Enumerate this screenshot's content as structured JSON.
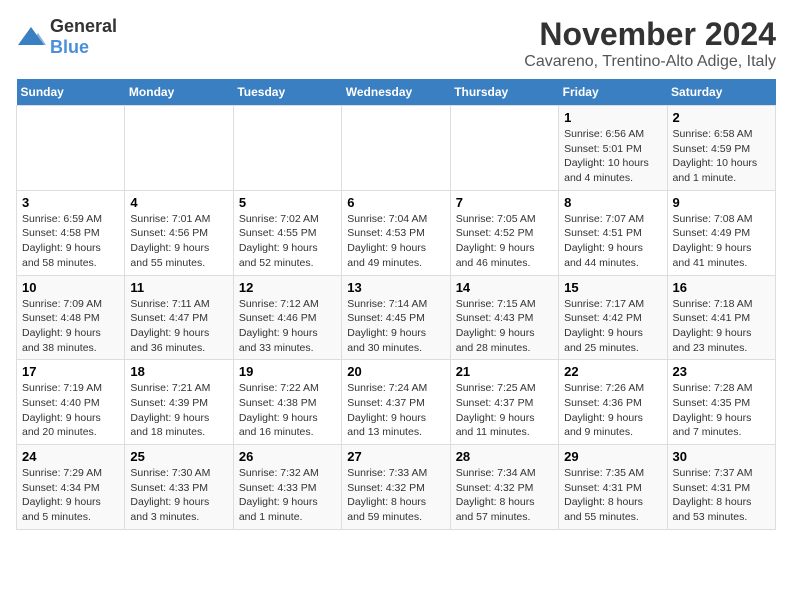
{
  "header": {
    "logo_general": "General",
    "logo_blue": "Blue",
    "title": "November 2024",
    "subtitle": "Cavareno, Trentino-Alto Adige, Italy"
  },
  "weekdays": [
    "Sunday",
    "Monday",
    "Tuesday",
    "Wednesday",
    "Thursday",
    "Friday",
    "Saturday"
  ],
  "weeks": [
    [
      {
        "day": "",
        "info": ""
      },
      {
        "day": "",
        "info": ""
      },
      {
        "day": "",
        "info": ""
      },
      {
        "day": "",
        "info": ""
      },
      {
        "day": "",
        "info": ""
      },
      {
        "day": "1",
        "info": "Sunrise: 6:56 AM\nSunset: 5:01 PM\nDaylight: 10 hours and 4 minutes."
      },
      {
        "day": "2",
        "info": "Sunrise: 6:58 AM\nSunset: 4:59 PM\nDaylight: 10 hours and 1 minute."
      }
    ],
    [
      {
        "day": "3",
        "info": "Sunrise: 6:59 AM\nSunset: 4:58 PM\nDaylight: 9 hours and 58 minutes."
      },
      {
        "day": "4",
        "info": "Sunrise: 7:01 AM\nSunset: 4:56 PM\nDaylight: 9 hours and 55 minutes."
      },
      {
        "day": "5",
        "info": "Sunrise: 7:02 AM\nSunset: 4:55 PM\nDaylight: 9 hours and 52 minutes."
      },
      {
        "day": "6",
        "info": "Sunrise: 7:04 AM\nSunset: 4:53 PM\nDaylight: 9 hours and 49 minutes."
      },
      {
        "day": "7",
        "info": "Sunrise: 7:05 AM\nSunset: 4:52 PM\nDaylight: 9 hours and 46 minutes."
      },
      {
        "day": "8",
        "info": "Sunrise: 7:07 AM\nSunset: 4:51 PM\nDaylight: 9 hours and 44 minutes."
      },
      {
        "day": "9",
        "info": "Sunrise: 7:08 AM\nSunset: 4:49 PM\nDaylight: 9 hours and 41 minutes."
      }
    ],
    [
      {
        "day": "10",
        "info": "Sunrise: 7:09 AM\nSunset: 4:48 PM\nDaylight: 9 hours and 38 minutes."
      },
      {
        "day": "11",
        "info": "Sunrise: 7:11 AM\nSunset: 4:47 PM\nDaylight: 9 hours and 36 minutes."
      },
      {
        "day": "12",
        "info": "Sunrise: 7:12 AM\nSunset: 4:46 PM\nDaylight: 9 hours and 33 minutes."
      },
      {
        "day": "13",
        "info": "Sunrise: 7:14 AM\nSunset: 4:45 PM\nDaylight: 9 hours and 30 minutes."
      },
      {
        "day": "14",
        "info": "Sunrise: 7:15 AM\nSunset: 4:43 PM\nDaylight: 9 hours and 28 minutes."
      },
      {
        "day": "15",
        "info": "Sunrise: 7:17 AM\nSunset: 4:42 PM\nDaylight: 9 hours and 25 minutes."
      },
      {
        "day": "16",
        "info": "Sunrise: 7:18 AM\nSunset: 4:41 PM\nDaylight: 9 hours and 23 minutes."
      }
    ],
    [
      {
        "day": "17",
        "info": "Sunrise: 7:19 AM\nSunset: 4:40 PM\nDaylight: 9 hours and 20 minutes."
      },
      {
        "day": "18",
        "info": "Sunrise: 7:21 AM\nSunset: 4:39 PM\nDaylight: 9 hours and 18 minutes."
      },
      {
        "day": "19",
        "info": "Sunrise: 7:22 AM\nSunset: 4:38 PM\nDaylight: 9 hours and 16 minutes."
      },
      {
        "day": "20",
        "info": "Sunrise: 7:24 AM\nSunset: 4:37 PM\nDaylight: 9 hours and 13 minutes."
      },
      {
        "day": "21",
        "info": "Sunrise: 7:25 AM\nSunset: 4:37 PM\nDaylight: 9 hours and 11 minutes."
      },
      {
        "day": "22",
        "info": "Sunrise: 7:26 AM\nSunset: 4:36 PM\nDaylight: 9 hours and 9 minutes."
      },
      {
        "day": "23",
        "info": "Sunrise: 7:28 AM\nSunset: 4:35 PM\nDaylight: 9 hours and 7 minutes."
      }
    ],
    [
      {
        "day": "24",
        "info": "Sunrise: 7:29 AM\nSunset: 4:34 PM\nDaylight: 9 hours and 5 minutes."
      },
      {
        "day": "25",
        "info": "Sunrise: 7:30 AM\nSunset: 4:33 PM\nDaylight: 9 hours and 3 minutes."
      },
      {
        "day": "26",
        "info": "Sunrise: 7:32 AM\nSunset: 4:33 PM\nDaylight: 9 hours and 1 minute."
      },
      {
        "day": "27",
        "info": "Sunrise: 7:33 AM\nSunset: 4:32 PM\nDaylight: 8 hours and 59 minutes."
      },
      {
        "day": "28",
        "info": "Sunrise: 7:34 AM\nSunset: 4:32 PM\nDaylight: 8 hours and 57 minutes."
      },
      {
        "day": "29",
        "info": "Sunrise: 7:35 AM\nSunset: 4:31 PM\nDaylight: 8 hours and 55 minutes."
      },
      {
        "day": "30",
        "info": "Sunrise: 7:37 AM\nSunset: 4:31 PM\nDaylight: 8 hours and 53 minutes."
      }
    ]
  ]
}
